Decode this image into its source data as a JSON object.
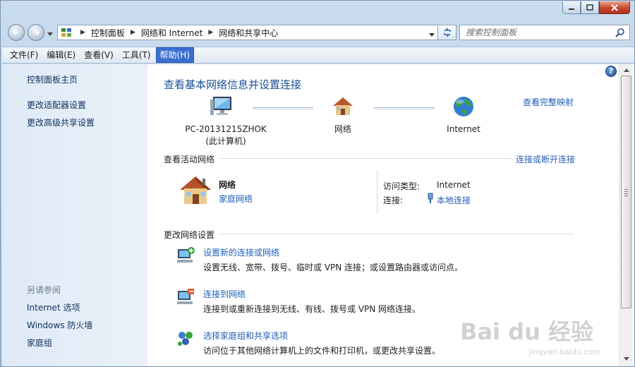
{
  "address": {
    "crumbs": [
      "控制面板",
      "网络和 Internet",
      "网络和共享中心"
    ]
  },
  "search": {
    "placeholder": "搜索控制面板"
  },
  "menu": [
    {
      "label": "文件(F)"
    },
    {
      "label": "编辑(E)"
    },
    {
      "label": "查看(V)"
    },
    {
      "label": "工具(T)"
    },
    {
      "label": "帮助(H)",
      "active": true
    }
  ],
  "sidebar": {
    "links": [
      "控制面板主页",
      "更改适配器设置",
      "更改高级共享设置"
    ],
    "see_also_heading": "另请参阅",
    "see_also": [
      "Internet 选项",
      "Windows 防火墙",
      "家庭组"
    ]
  },
  "main": {
    "title": "查看基本网络信息并设置连接",
    "full_map_link": "查看完整映射",
    "nodes": [
      {
        "label_line1": "PC-20131215ZHOK",
        "label_line2": "(此计算机)"
      },
      {
        "label_line1": "网络"
      },
      {
        "label_line1": "Internet"
      }
    ],
    "active_networks": {
      "heading": "查看活动网络",
      "connect_link": "连接或断开连接",
      "network_name": "网络",
      "network_type": "家庭网络",
      "access_type_label": "访问类型:",
      "access_type_value": "Internet",
      "connections_label": "连接:",
      "connections_value": "本地连接"
    },
    "change_settings": {
      "heading": "更改网络设置",
      "tasks": [
        {
          "link": "设置新的连接或网络",
          "desc": "设置无线、宽带、拨号、临时或 VPN 连接；或设置路由器或访问点。"
        },
        {
          "link": "连接到网络",
          "desc": "连接到或重新连接到无线、有线、拨号或 VPN 网络连接。"
        },
        {
          "link": "选择家庭组和共享选项",
          "desc": "访问位于其他网络计算机上的文件和打印机，或更改共享设置。"
        }
      ]
    }
  },
  "watermark": {
    "main": "Bai du 经验",
    "sub": "jingyan.baidu.com"
  },
  "colors": {
    "link": "#1f5fb8",
    "title": "#1a4f98",
    "menu_active": "#3a6fd1"
  }
}
